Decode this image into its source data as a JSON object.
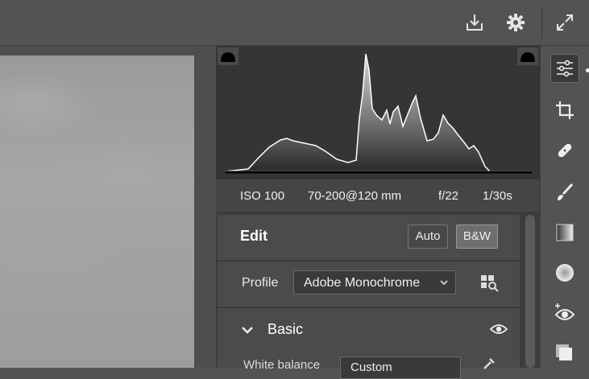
{
  "toolbar": {
    "icons": [
      "download-icon",
      "gear-icon",
      "expand-icon"
    ]
  },
  "histogram": {
    "clip_shadows": "shadow-clip-icon",
    "clip_highlights": "highlight-clip-icon"
  },
  "metadata": {
    "iso": "ISO 100",
    "lens": "70-200@120 mm",
    "aperture": "f/22",
    "shutter": "1/30s"
  },
  "edit": {
    "title": "Edit",
    "auto_label": "Auto",
    "bw_label": "B&W"
  },
  "profile": {
    "label": "Profile",
    "value": "Adobe Monochrome"
  },
  "basic": {
    "title": "Basic",
    "white_balance_label": "White balance",
    "white_balance_value": "Custom"
  },
  "tools": [
    "sliders-icon",
    "crop-icon",
    "healing-icon",
    "brush-icon",
    "gradient-icon",
    "radial-icon",
    "redeye-icon",
    "presets-icon"
  ],
  "colors": {
    "panel": "#3c3c3c",
    "section": "#4b4b4b",
    "chrome": "#535353"
  }
}
